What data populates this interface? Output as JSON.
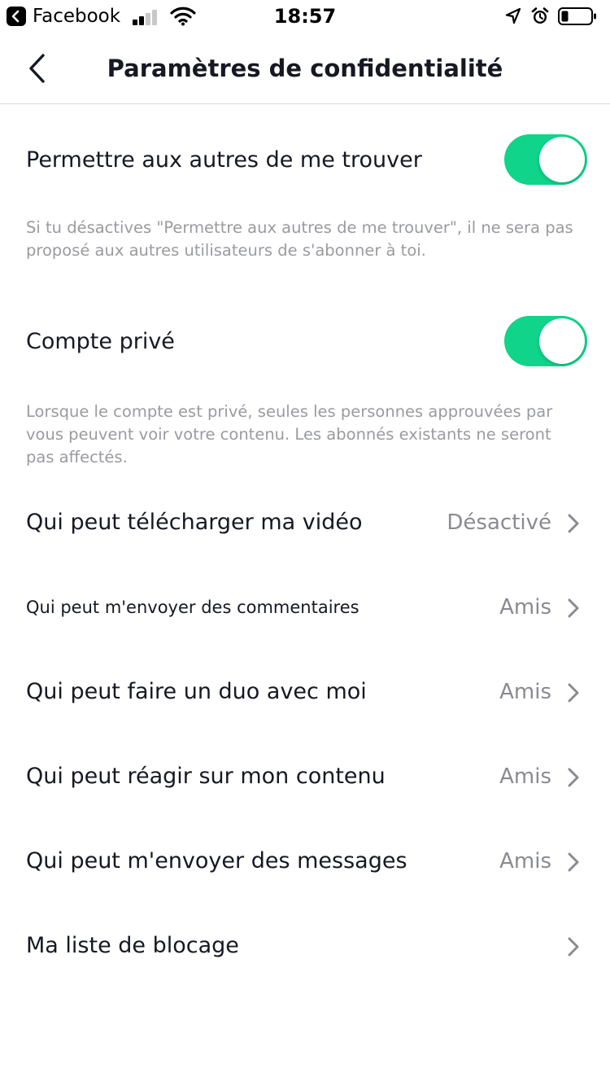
{
  "status_bar": {
    "back_app": "Facebook",
    "time": "18:57",
    "icons": [
      "back-app-icon",
      "signal-icon",
      "wifi-icon",
      "location-icon",
      "alarm-icon",
      "battery-icon"
    ]
  },
  "nav": {
    "title": "Paramètres de confidentialité",
    "back_icon": "chevron-left-icon"
  },
  "toggles": [
    {
      "label": "Permettre aux autres de me trouver",
      "on": true,
      "description": "Si tu désactives \"Permettre aux autres de me trouver\", il ne sera pas proposé aux autres utilisateurs de s'abonner à toi."
    },
    {
      "label": "Compte privé",
      "on": true,
      "description": "Lorsque le compte est privé, seules les personnes approuvées par vous peuvent voir votre contenu. Les abonnés existants ne seront pas affectés."
    }
  ],
  "settings": [
    {
      "label": "Qui peut télécharger ma vidéo",
      "value": "Désactivé"
    },
    {
      "label": "Qui peut m'envoyer des commentaires",
      "value": "Amis"
    },
    {
      "label": "Qui peut faire un duo avec moi",
      "value": "Amis"
    },
    {
      "label": "Qui peut réagir sur mon contenu",
      "value": "Amis"
    },
    {
      "label": "Qui peut m'envoyer des messages",
      "value": "Amis"
    },
    {
      "label": "Ma liste de blocage",
      "value": ""
    }
  ],
  "colors": {
    "toggle_on": "#0fd48a",
    "text_primary": "#161823",
    "text_secondary": "#9a9ba0",
    "value_text": "#8a8b91",
    "chevron": "#8a8b91"
  }
}
